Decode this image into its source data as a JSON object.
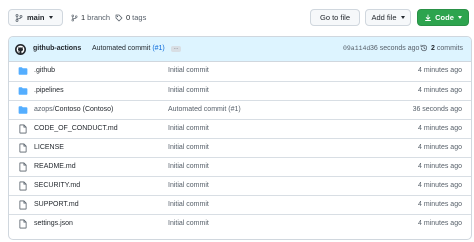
{
  "colors": {
    "accent": "#0969da",
    "folder": "#54aeff",
    "code_button": "#2da44e",
    "commit_bar": "#ddf4ff"
  },
  "toolbar": {
    "branch_label": "main",
    "branches_count": "1",
    "branches_label": "branch",
    "tags_count": "0",
    "tags_label": "tags",
    "goto_file_label": "Go to file",
    "add_file_label": "Add file",
    "code_label": "Code"
  },
  "latest_commit": {
    "author": "github-actions",
    "message": "Automated commit",
    "pr_ref": "(#1)",
    "ellipsis": "…",
    "sha": "09a114d",
    "time": "36 seconds ago",
    "commits_count": "2",
    "commits_label": "commits"
  },
  "files": [
    {
      "type": "folder",
      "icon": "folder-icon",
      "name": ".github",
      "message": "Initial commit",
      "time": "4 minutes ago"
    },
    {
      "type": "folder",
      "icon": "folder-icon",
      "name": ".pipelines",
      "message": "Initial commit",
      "time": "4 minutes ago"
    },
    {
      "type": "folder",
      "icon": "folder-icon",
      "name_prefix": "azops/",
      "name": "Contoso (Contoso)",
      "message": "Automated commit (#1)",
      "time": "36 seconds ago"
    },
    {
      "type": "file",
      "icon": "file-icon",
      "name": "CODE_OF_CONDUCT.md",
      "message": "Initial commit",
      "time": "4 minutes ago"
    },
    {
      "type": "file",
      "icon": "file-icon",
      "name": "LICENSE",
      "message": "Initial commit",
      "time": "4 minutes ago"
    },
    {
      "type": "file",
      "icon": "file-icon",
      "name": "README.md",
      "message": "Initial commit",
      "time": "4 minutes ago"
    },
    {
      "type": "file",
      "icon": "file-icon",
      "name": "SECURITY.md",
      "message": "Initial commit",
      "time": "4 minutes ago"
    },
    {
      "type": "file",
      "icon": "file-icon",
      "name": "SUPPORT.md",
      "message": "Initial commit",
      "time": "4 minutes ago"
    },
    {
      "type": "file",
      "icon": "file-icon",
      "name": "settings.json",
      "message": "Initial commit",
      "time": "4 minutes ago"
    }
  ]
}
